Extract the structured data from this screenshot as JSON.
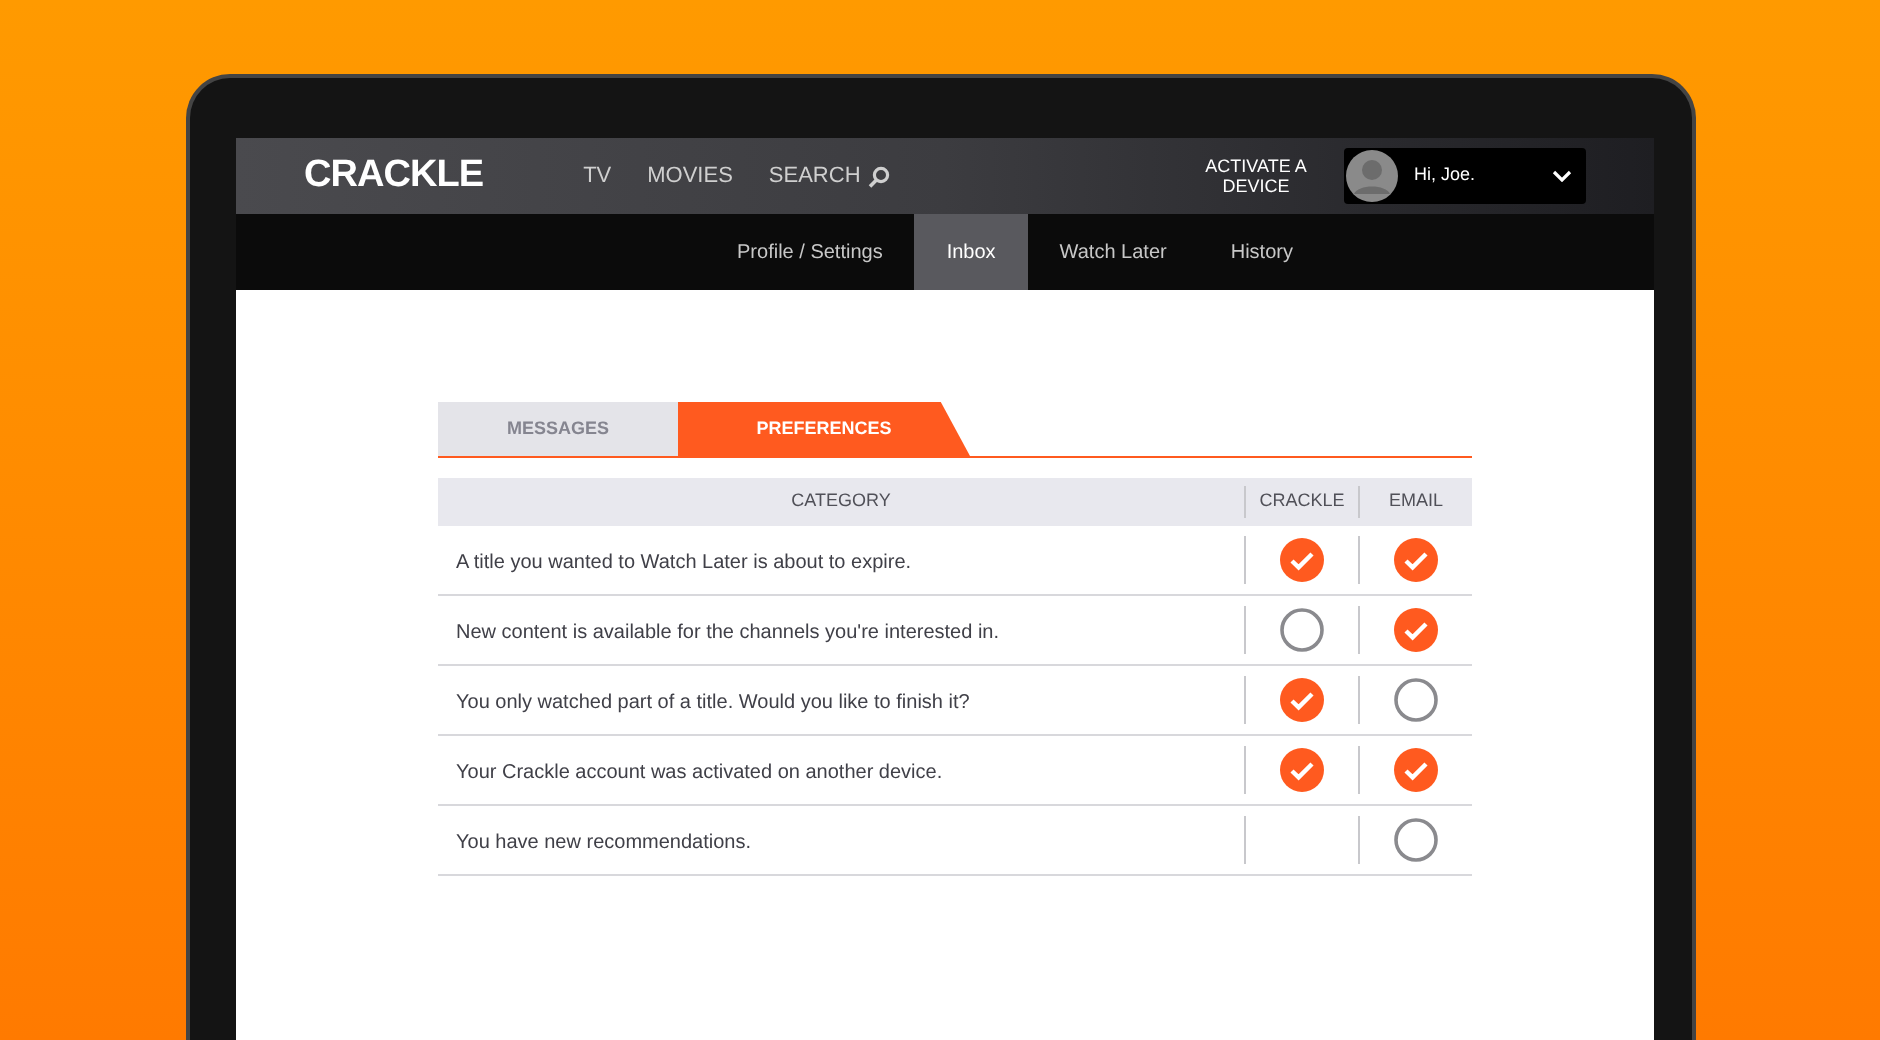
{
  "header": {
    "logo": "CRACKLE",
    "nav": [
      {
        "label": "TV"
      },
      {
        "label": "MOVIES"
      },
      {
        "label": "SEARCH"
      }
    ],
    "activate": "ACTIVATE A DEVICE",
    "user": "Hi, Joe."
  },
  "subnav": [
    {
      "label": "Profile / Settings",
      "selected": false
    },
    {
      "label": "Inbox",
      "selected": true
    },
    {
      "label": "Watch Later",
      "selected": false
    },
    {
      "label": "History",
      "selected": false
    }
  ],
  "tabs": [
    {
      "label": "MESSAGES",
      "selected": false
    },
    {
      "label": "PREFERENCES",
      "selected": true
    }
  ],
  "table": {
    "columns": [
      "CATEGORY",
      "CRACKLE",
      "EMAIL"
    ],
    "rows": [
      {
        "category": "A title you wanted to Watch Later is about to expire.",
        "crackle": {
          "checked": true
        },
        "email": {
          "checked": true
        }
      },
      {
        "category": "New content is available for the channels you're interested in.",
        "crackle": {
          "checked": false
        },
        "email": {
          "checked": true
        }
      },
      {
        "category": "You only watched part of a title. Would you like to finish it?",
        "crackle": {
          "checked": true
        },
        "email": {
          "checked": false
        }
      },
      {
        "category": "Your Crackle account was activated on another device.",
        "crackle": {
          "checked": true
        },
        "email": {
          "checked": true
        }
      },
      {
        "category": "You have new recommendations.",
        "email": {
          "checked": false
        }
      }
    ]
  }
}
